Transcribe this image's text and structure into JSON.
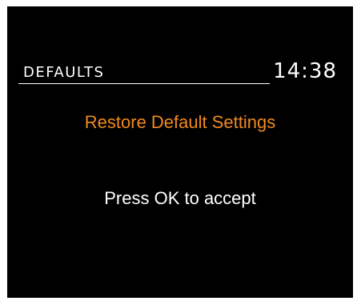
{
  "header": {
    "title": "DEFAULTS",
    "time": "14:38"
  },
  "main": {
    "heading": "Restore Default Settings",
    "instruction": "Press OK to accept"
  },
  "colors": {
    "background": "#000000",
    "text": "#ffffff",
    "accent": "#f08a1e"
  }
}
